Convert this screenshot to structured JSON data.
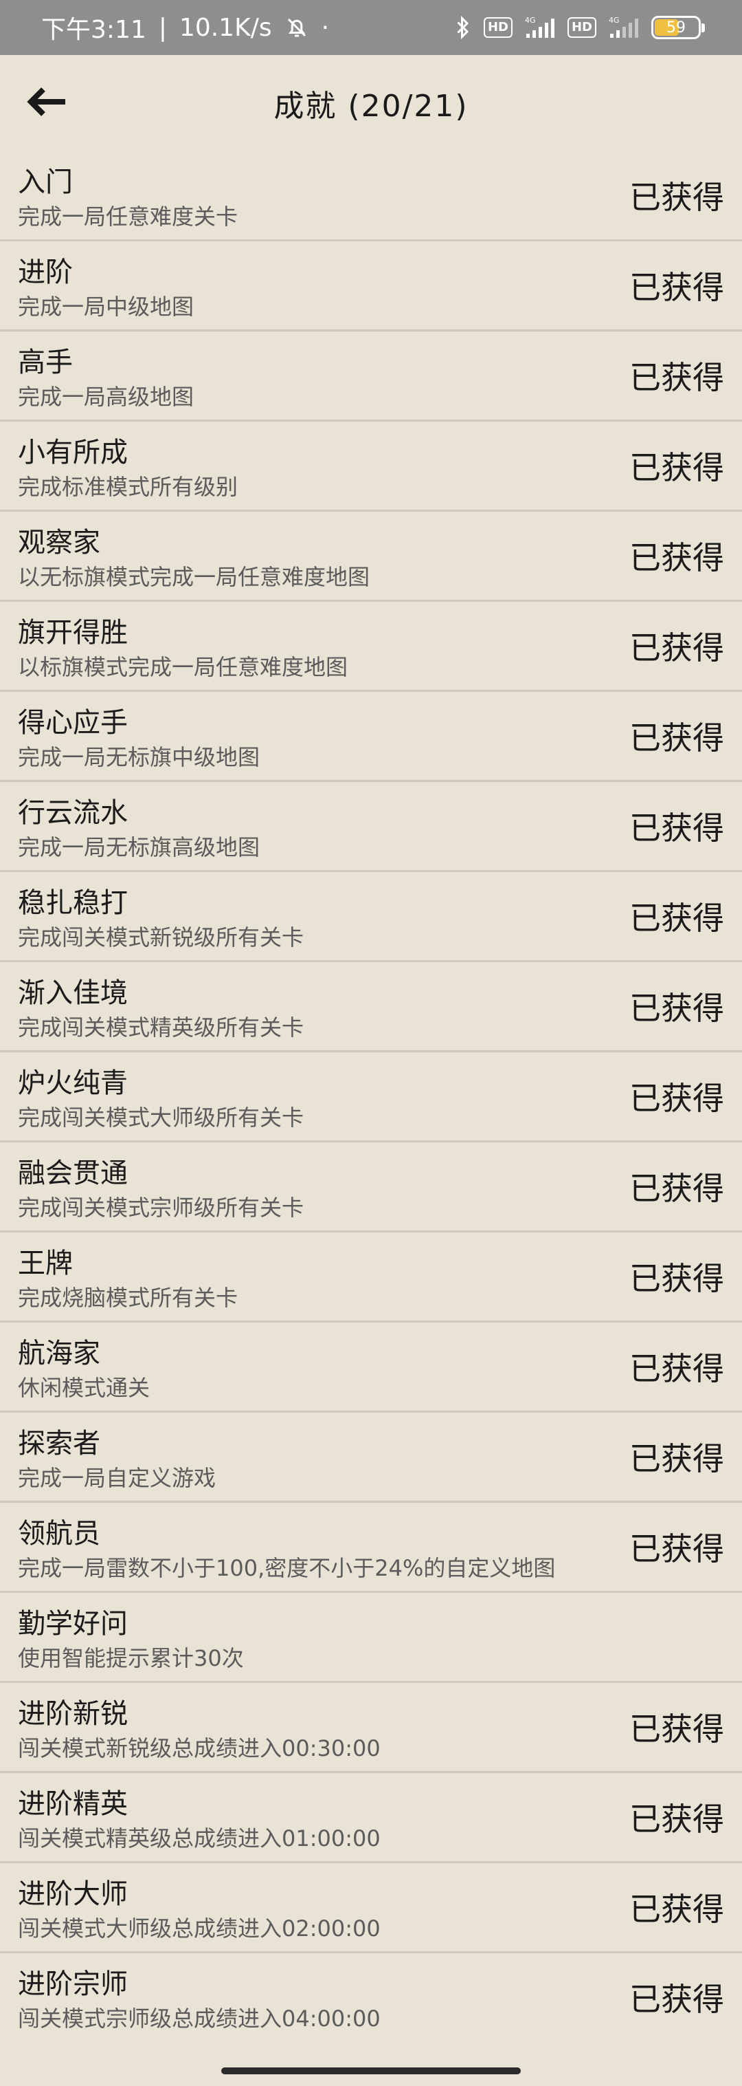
{
  "status_bar": {
    "time": "下午3:11",
    "net_speed": "10.1K/s",
    "separator": "|",
    "dot": "·",
    "hd_label": "HD",
    "net_label": "4G",
    "battery_level": "59"
  },
  "header": {
    "title": "成就 (20/21)"
  },
  "achievements": [
    {
      "title": "入门",
      "desc": "完成一局任意难度关卡",
      "status": "已获得"
    },
    {
      "title": "进阶",
      "desc": "完成一局中级地图",
      "status": "已获得"
    },
    {
      "title": "高手",
      "desc": "完成一局高级地图",
      "status": "已获得"
    },
    {
      "title": "小有所成",
      "desc": "完成标准模式所有级别",
      "status": "已获得"
    },
    {
      "title": "观察家",
      "desc": "以无标旗模式完成一局任意难度地图",
      "status": "已获得"
    },
    {
      "title": "旗开得胜",
      "desc": "以标旗模式完成一局任意难度地图",
      "status": "已获得"
    },
    {
      "title": "得心应手",
      "desc": "完成一局无标旗中级地图",
      "status": "已获得"
    },
    {
      "title": "行云流水",
      "desc": "完成一局无标旗高级地图",
      "status": "已获得"
    },
    {
      "title": "稳扎稳打",
      "desc": "完成闯关模式新锐级所有关卡",
      "status": "已获得"
    },
    {
      "title": "渐入佳境",
      "desc": "完成闯关模式精英级所有关卡",
      "status": "已获得"
    },
    {
      "title": "炉火纯青",
      "desc": "完成闯关模式大师级所有关卡",
      "status": "已获得"
    },
    {
      "title": "融会贯通",
      "desc": "完成闯关模式宗师级所有关卡",
      "status": "已获得"
    },
    {
      "title": "王牌",
      "desc": "完成烧脑模式所有关卡",
      "status": "已获得"
    },
    {
      "title": "航海家",
      "desc": "休闲模式通关",
      "status": "已获得"
    },
    {
      "title": "探索者",
      "desc": "完成一局自定义游戏",
      "status": "已获得"
    },
    {
      "title": "领航员",
      "desc": "完成一局雷数不小于100,密度不小于24%的自定义地图",
      "status": "已获得"
    },
    {
      "title": "勤学好问",
      "desc": "使用智能提示累计30次",
      "status": ""
    },
    {
      "title": "进阶新锐",
      "desc": "闯关模式新锐级总成绩进入00:30:00",
      "status": "已获得"
    },
    {
      "title": "进阶精英",
      "desc": "闯关模式精英级总成绩进入01:00:00",
      "status": "已获得"
    },
    {
      "title": "进阶大师",
      "desc": "闯关模式大师级总成绩进入02:00:00",
      "status": "已获得"
    },
    {
      "title": "进阶宗师",
      "desc": "闯关模式宗师级总成绩进入04:00:00",
      "status": "已获得"
    }
  ]
}
